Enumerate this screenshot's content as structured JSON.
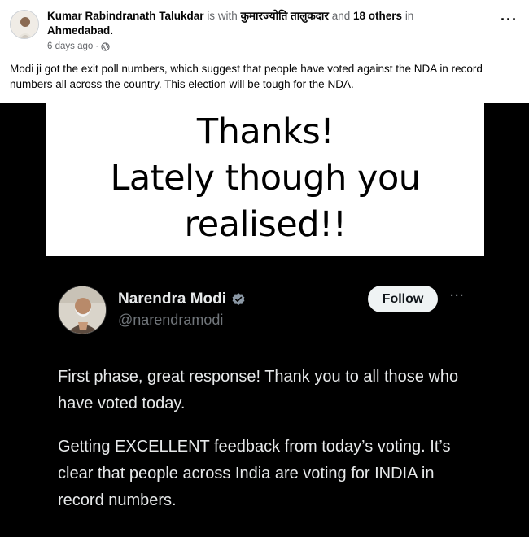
{
  "post": {
    "author": "Kumar Rabindranath Talukdar",
    "with_text": "is with",
    "tagged_person": "कुमारज्योति तालुकदार",
    "and_text": "and",
    "others": "18 others",
    "in_text": "in",
    "location": "Ahmedabad.",
    "timestamp": "6 days ago",
    "meta_separator": "·",
    "privacy_icon": "globe-icon",
    "more_icon": "more-dots-icon",
    "caption": "Modi ji got the exit poll numbers, which suggest that people have voted against the NDA in record numbers all across the country. This election will be tough for the NDA."
  },
  "banner": {
    "line1": "Thanks!",
    "line2": "Lately though you",
    "line3": "realised!!"
  },
  "tweet": {
    "name": "Narendra Modi",
    "verified_icon": "verified-badge-icon",
    "handle": "@narendramodi",
    "follow_label": "Follow",
    "more_icon": "more-dots-icon",
    "paragraph1": "First phase, great response! Thank you to all those who have voted today.",
    "paragraph2": "Getting EXCELLENT feedback from today’s voting. It’s clear that people across India are voting  for INDIA in record numbers."
  },
  "colors": {
    "tweet_background": "#000000",
    "tweet_text": "#e7e9ea",
    "tweet_muted": "#71767b",
    "verified_blue": "#1d9bf0",
    "fb_muted": "#65676b"
  }
}
